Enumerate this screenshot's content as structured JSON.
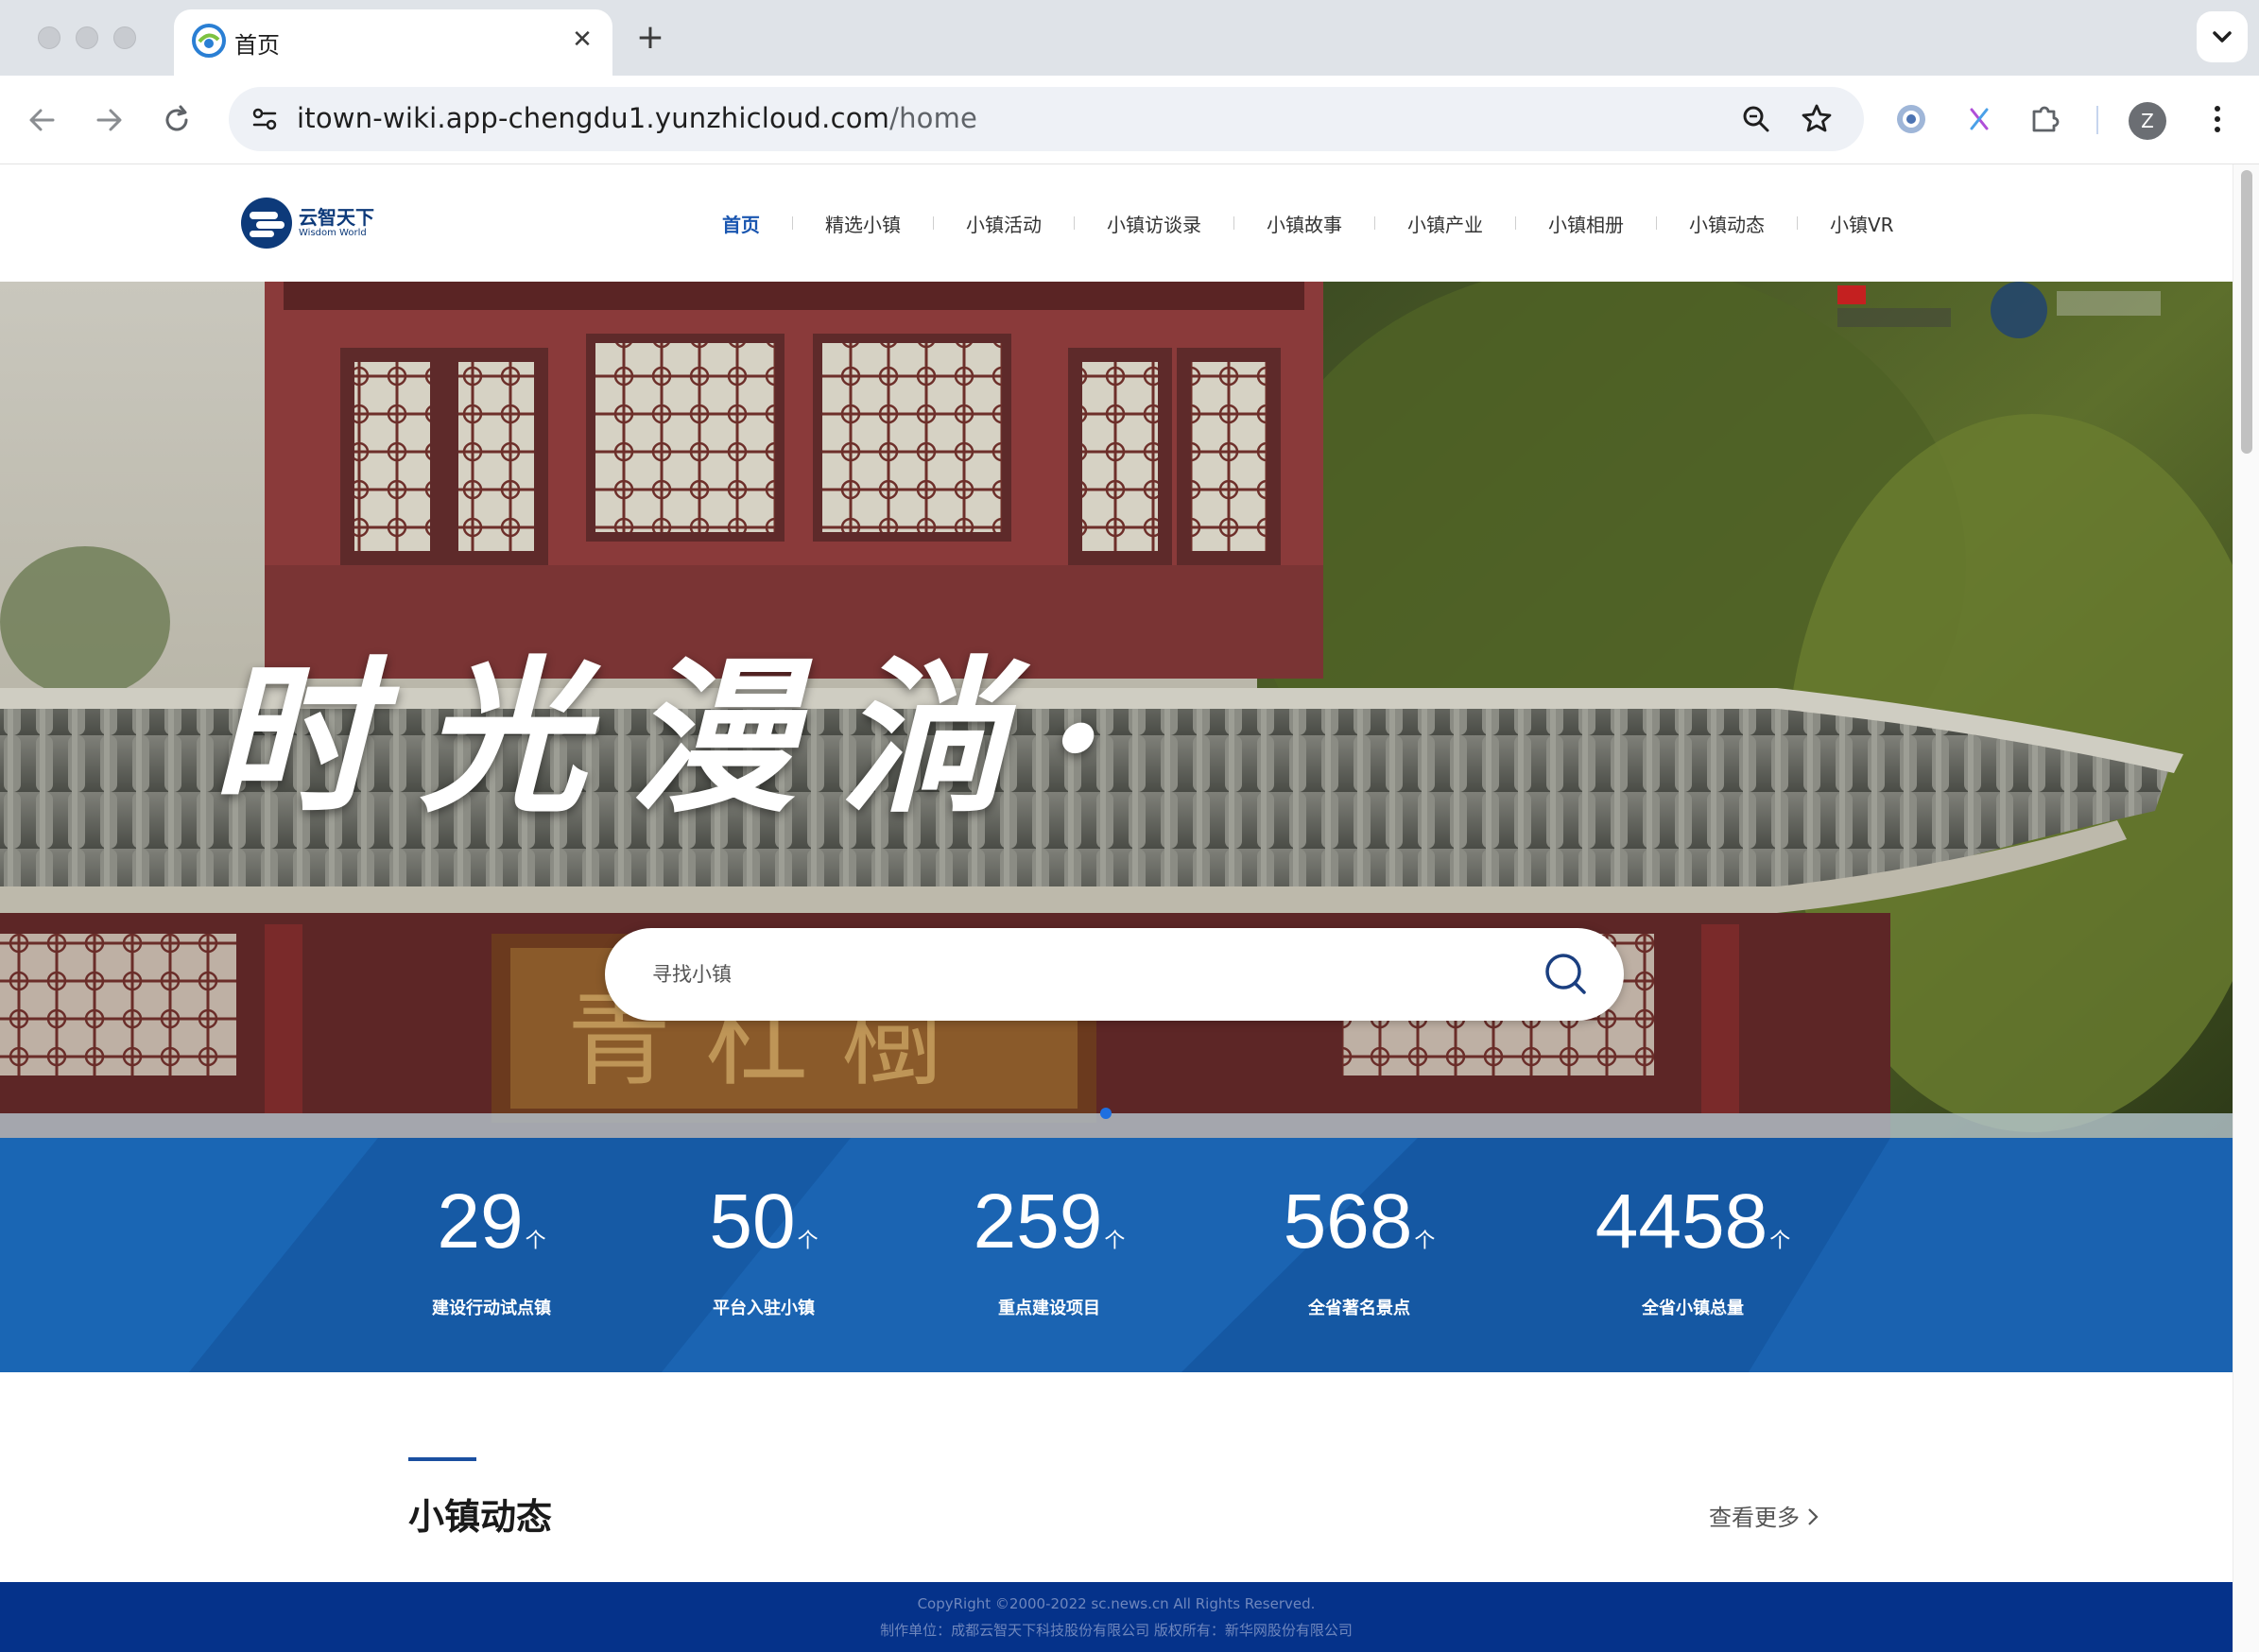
{
  "browser": {
    "tab_title": "首页",
    "tab_close": "✕",
    "new_tab": "+",
    "url_host": "itown-wiki.app-chengdu1.yunzhicloud.com",
    "url_path": "/home",
    "profile_initial": "Z"
  },
  "site": {
    "logo_cn": "云智天下",
    "logo_en": "Wisdom World",
    "menu": [
      {
        "label": "首页",
        "active": true
      },
      {
        "label": "精选小镇"
      },
      {
        "label": "小镇活动"
      },
      {
        "label": "小镇访谈录"
      },
      {
        "label": "小镇故事"
      },
      {
        "label": "小镇产业"
      },
      {
        "label": "小镇相册"
      },
      {
        "label": "小镇动态"
      },
      {
        "label": "小镇VR"
      }
    ]
  },
  "hero": {
    "title": "时光漫淌·",
    "search_placeholder": "寻找小镇"
  },
  "stats": [
    {
      "value": "29",
      "unit": "个",
      "label": "建设行动试点镇"
    },
    {
      "value": "50",
      "unit": "个",
      "label": "平台入驻小镇"
    },
    {
      "value": "259",
      "unit": "个",
      "label": "重点建设项目"
    },
    {
      "value": "568",
      "unit": "个",
      "label": "全省著名景点"
    },
    {
      "value": "4458",
      "unit": "个",
      "label": "全省小镇总量"
    }
  ],
  "section": {
    "title": "小镇动态",
    "more": "查看更多"
  },
  "footer": {
    "line1": "CopyRight ©2000-2022 sc.news.cn All Rights Reserved.",
    "line2": "制作单位：成都云智天下科技股份有限公司 版权所有：新华网股份有限公司"
  },
  "colors": {
    "brand_blue": "#1a56b0",
    "stats_bg": "#1860ad",
    "footer_bg": "#05328a"
  }
}
